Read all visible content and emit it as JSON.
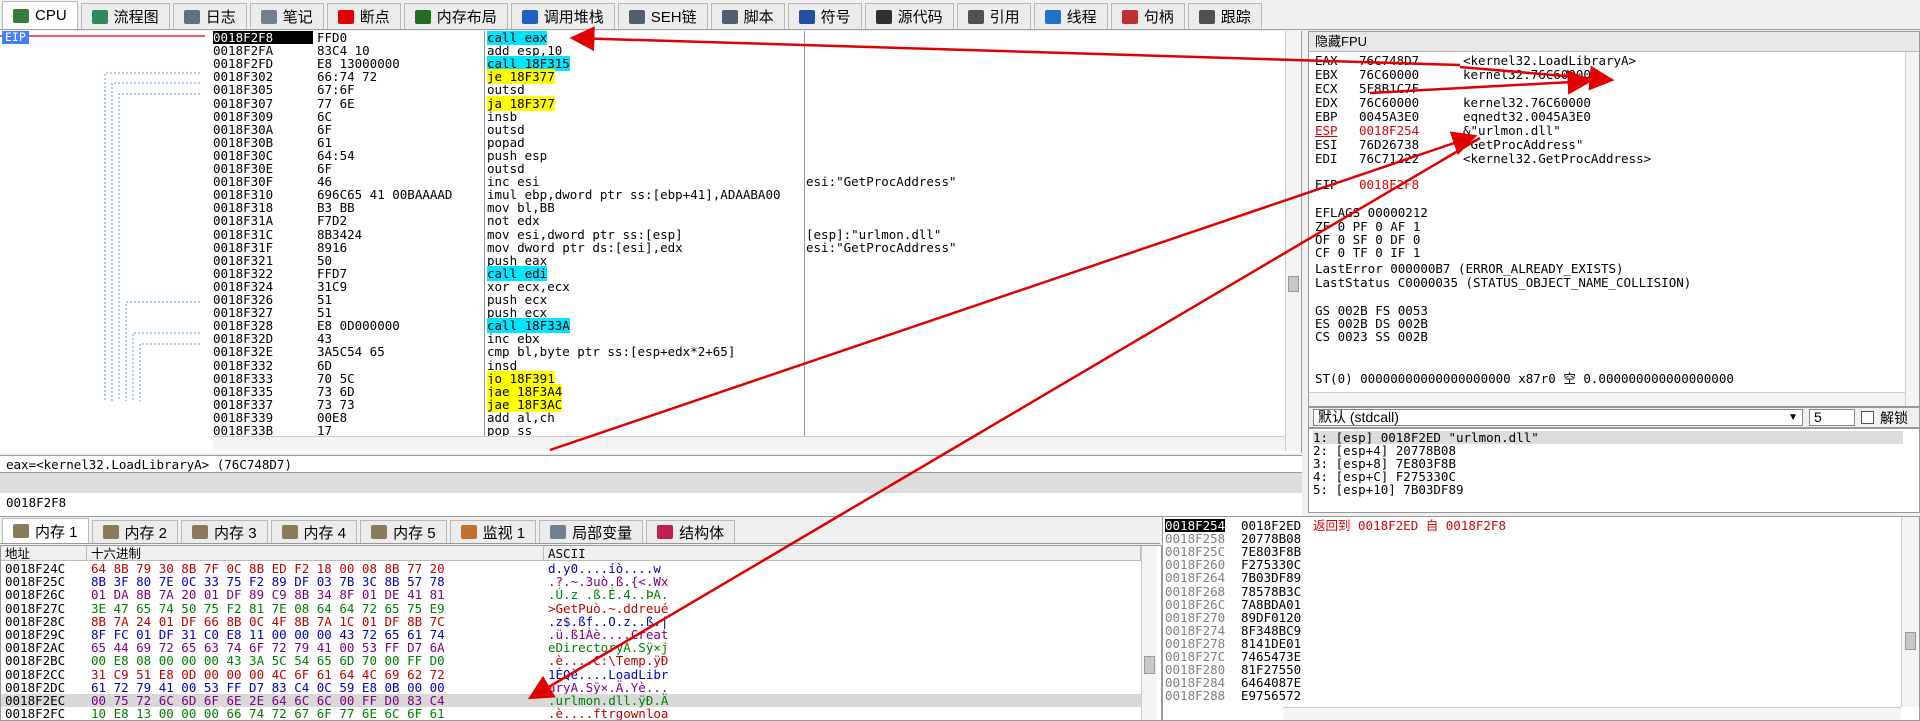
{
  "tabs": [
    {
      "label": "CPU",
      "icon": "cpu-icon",
      "color": "#3a7a3a"
    },
    {
      "label": "流程图",
      "icon": "graph-icon",
      "color": "#2e8b57"
    },
    {
      "label": "日志",
      "icon": "log-icon",
      "color": "#607080"
    },
    {
      "label": "笔记",
      "icon": "notes-icon",
      "color": "#708090"
    },
    {
      "label": "断点",
      "icon": "breakpoint-icon",
      "color": "#e00000"
    },
    {
      "label": "内存布局",
      "icon": "memory-map-icon",
      "color": "#207020"
    },
    {
      "label": "调用堆栈",
      "icon": "call-stack-icon",
      "color": "#2060c0"
    },
    {
      "label": "SEH链",
      "icon": "seh-icon",
      "color": "#506070"
    },
    {
      "label": "脚本",
      "icon": "script-icon",
      "color": "#506070"
    },
    {
      "label": "符号",
      "icon": "symbols-icon",
      "color": "#2050a0"
    },
    {
      "label": "源代码",
      "icon": "source-icon",
      "color": "#303030"
    },
    {
      "label": "引用",
      "icon": "references-icon",
      "color": "#505050"
    },
    {
      "label": "线程",
      "icon": "threads-icon",
      "color": "#2070d0"
    },
    {
      "label": "句柄",
      "icon": "handles-icon",
      "color": "#c03030"
    },
    {
      "label": "跟踪",
      "icon": "trace-icon",
      "color": "#505050"
    }
  ],
  "disasm": {
    "eip_label": "EIP",
    "rows": [
      {
        "addr": "0018F2F8",
        "bytes": "FFD0",
        "ins": "call eax",
        "cmt": ""
      },
      {
        "addr": "0018F2FA",
        "bytes": "83C4 10",
        "ins": "add esp,10",
        "cmt": ""
      },
      {
        "addr": "0018F2FD",
        "bytes": "E8 13000000",
        "ins": "call 18F315",
        "cmt": ""
      },
      {
        "addr": "0018F302",
        "bytes": "66:74 72",
        "ins": "je 18F377",
        "cmt": ""
      },
      {
        "addr": "0018F305",
        "bytes": "67:6F",
        "ins": "outsd",
        "cmt": ""
      },
      {
        "addr": "0018F307",
        "bytes": "77 6E",
        "ins": "ja 18F377",
        "cmt": ""
      },
      {
        "addr": "0018F309",
        "bytes": "6C",
        "ins": "insb",
        "cmt": ""
      },
      {
        "addr": "0018F30A",
        "bytes": "6F",
        "ins": "outsd",
        "cmt": ""
      },
      {
        "addr": "0018F30B",
        "bytes": "61",
        "ins": "popad",
        "cmt": ""
      },
      {
        "addr": "0018F30C",
        "bytes": "64:54",
        "ins": "push esp",
        "cmt": ""
      },
      {
        "addr": "0018F30E",
        "bytes": "6F",
        "ins": "outsd",
        "cmt": ""
      },
      {
        "addr": "0018F30F",
        "bytes": "46",
        "ins": "inc esi",
        "cmt": "esi:\"GetProcAddress\""
      },
      {
        "addr": "0018F310",
        "bytes": "696C65 41 00BAAAAD",
        "ins": "imul ebp,dword ptr ss:[ebp+41],ADAABA00",
        "cmt": ""
      },
      {
        "addr": "0018F318",
        "bytes": "B3 BB",
        "ins": "mov bl,BB",
        "cmt": ""
      },
      {
        "addr": "0018F31A",
        "bytes": "F7D2",
        "ins": "not edx",
        "cmt": ""
      },
      {
        "addr": "0018F31C",
        "bytes": "8B3424",
        "ins": "mov esi,dword ptr ss:[esp]",
        "cmt": "[esp]:\"urlmon.dll\""
      },
      {
        "addr": "0018F31F",
        "bytes": "8916",
        "ins": "mov dword ptr ds:[esi],edx",
        "cmt": "esi:\"GetProcAddress\""
      },
      {
        "addr": "0018F321",
        "bytes": "50",
        "ins": "push eax",
        "cmt": ""
      },
      {
        "addr": "0018F322",
        "bytes": "FFD7",
        "ins": "call edi",
        "cmt": ""
      },
      {
        "addr": "0018F324",
        "bytes": "31C9",
        "ins": "xor ecx,ecx",
        "cmt": ""
      },
      {
        "addr": "0018F326",
        "bytes": "51",
        "ins": "push ecx",
        "cmt": ""
      },
      {
        "addr": "0018F327",
        "bytes": "51",
        "ins": "push ecx",
        "cmt": ""
      },
      {
        "addr": "0018F328",
        "bytes": "E8 0D000000",
        "ins": "call 18F33A",
        "cmt": ""
      },
      {
        "addr": "0018F32D",
        "bytes": "43",
        "ins": "inc ebx",
        "cmt": ""
      },
      {
        "addr": "0018F32E",
        "bytes": "3A5C54 65",
        "ins": "cmp bl,byte ptr ss:[esp+edx*2+65]",
        "cmt": ""
      },
      {
        "addr": "0018F332",
        "bytes": "6D",
        "ins": "insd",
        "cmt": ""
      },
      {
        "addr": "0018F333",
        "bytes": "70 5C",
        "ins": "jo 18F391",
        "cmt": ""
      },
      {
        "addr": "0018F335",
        "bytes": "73 6D",
        "ins": "jae 18F3A4",
        "cmt": ""
      },
      {
        "addr": "0018F337",
        "bytes": "73 73",
        "ins": "jae 18F3AC",
        "cmt": ""
      },
      {
        "addr": "0018F339",
        "bytes": "00E8",
        "ins": "add al,ch",
        "cmt": ""
      },
      {
        "addr": "0018F33B",
        "bytes": "17",
        "ins": "pop ss",
        "cmt": ""
      }
    ]
  },
  "info": {
    "line1": "eax=<kernel32.LoadLibraryA> (76C748D7)",
    "line2": "0018F2F8"
  },
  "registers": {
    "title": "隐藏FPU",
    "gp": [
      {
        "name": "EAX",
        "val": "76C748D7",
        "desc": "<kernel32.LoadLibraryA>"
      },
      {
        "name": "EBX",
        "val": "76C60000",
        "desc": "kernel32.76C60000"
      },
      {
        "name": "ECX",
        "val": "5F8B1C7F",
        "desc": ""
      },
      {
        "name": "EDX",
        "val": "76C60000",
        "desc": "kernel32.76C60000"
      },
      {
        "name": "EBP",
        "val": "0045A3E0",
        "desc": "eqnedt32.0045A3E0"
      },
      {
        "name": "ESP",
        "val": "0018F254",
        "desc": "&\"urlmon.dll\""
      },
      {
        "name": "ESI",
        "val": "76D26738",
        "desc": "\"GetProcAddress\""
      },
      {
        "name": "EDI",
        "val": "76C71222",
        "desc": "<kernel32.GetProcAddress>"
      }
    ],
    "eip": {
      "name": "EIP",
      "val": "0018F2F8"
    },
    "eflags": "EFLAGS   00000212",
    "flags": [
      "ZF 0  PF 0  AF 1",
      "OF 0  SF 0  DF 0",
      "CF 0  TF 0  IF 1"
    ],
    "lasterror": "LastError  000000B7 (ERROR_ALREADY_EXISTS)",
    "laststatus": "LastStatus C0000035 (STATUS_OBJECT_NAME_COLLISION)",
    "segs": [
      "GS 002B  FS 0053",
      "ES 002B  DS 002B",
      "CS 0023  SS 002B"
    ],
    "st0": "ST(0) 00000000000000000000 x87r0 空 0.000000000000000000"
  },
  "callconv": {
    "selected": "默认 (stdcall)",
    "count": "5",
    "unlock_label": "解锁",
    "rows": [
      "1: [esp] 0018F2ED \"urlmon.dll\"",
      "2: [esp+4] 20778B08",
      "3: [esp+8] 7E803F8B",
      "4: [esp+C] F275330C",
      "5: [esp+10] 7B03DF89"
    ]
  },
  "memtabs": [
    {
      "label": "内存 1"
    },
    {
      "label": "内存 2"
    },
    {
      "label": "内存 3"
    },
    {
      "label": "内存 4"
    },
    {
      "label": "内存 5"
    },
    {
      "label": "监视 1"
    },
    {
      "label": "局部变量"
    },
    {
      "label": "结构体"
    }
  ],
  "dump": {
    "headers": {
      "addr": "地址",
      "hex": "十六进制",
      "ascii": "ASCII"
    },
    "rows": [
      {
        "addr": "0018F24C",
        "hex": "64 8B 79 30 8B 7F 0C 8B ED F2 18 00 08 8B 77 20",
        "ascii": "d.y0....íò....w "
      },
      {
        "addr": "0018F25C",
        "hex": "8B 3F 80 7E 0C 33 75 F2 89 DF 03 7B 3C 8B 57 78",
        "ascii": ".?.~.3uò.ß.{<.Wx"
      },
      {
        "addr": "0018F26C",
        "hex": "01 DA 8B 7A 20 01 DF 89 C9 8B 34 8F 01 DE 41 81",
        "ascii": ".Ú.z .ß.É.4..ÞA."
      },
      {
        "addr": "0018F27C",
        "hex": "3E 47 65 74 50 75 F2 81 7E 08 64 64 72 65 75 E9",
        "ascii": ">GetPuò.~.ddreué"
      },
      {
        "addr": "0018F28C",
        "hex": "8B 7A 24 01 DF 66 8B 0C 4F 8B 7A 1C 01 DF 8B 7C",
        "ascii": ".z$.ßf..O.z..ß.|"
      },
      {
        "addr": "0018F29C",
        "hex": "8F FC 01 DF 31 C0 E8 11 00 00 00 43 72 65 61 74",
        "ascii": ".ü.ß1Àè....Creat"
      },
      {
        "addr": "0018F2AC",
        "hex": "65 44 69 72 65 63 74 6F 72 79 41 00 53 FF D7 6A",
        "ascii": "eDirectoryA.Sÿ×j"
      },
      {
        "addr": "0018F2BC",
        "hex": "00 E8 08 00 00 00 43 3A 5C 54 65 6D 70 00 FF D0",
        "ascii": ".è....C:\\Temp.ÿÐ"
      },
      {
        "addr": "0018F2CC",
        "hex": "31 C9 51 E8 0D 00 00 00 4C 6F 61 64 4C 69 62 72",
        "ascii": "1ÉQè....LoadLibr"
      },
      {
        "addr": "0018F2DC",
        "hex": "61 72 79 41 00 53 FF D7 83 C4 0C 59 E8 0B 00 00",
        "ascii": "aryA.Sÿ×.Ä.Yè..."
      },
      {
        "addr": "0018F2EC",
        "hex": "00 75 72 6C 6D 6F 6E 2E 64 6C 6C 00 FF D0 83 C4",
        "ascii": ".urlmon.dll.ÿÐ.Ä"
      },
      {
        "addr": "0018F2FC",
        "hex": "10 E8 13 00 00 00 66 74 72 67 6F 77 6E 6C 6F 61",
        "ascii": ".è....ftrgownloa"
      }
    ]
  },
  "stack": {
    "rows": [
      {
        "addr": "0018F254",
        "val": "0018F2ED",
        "cmt": "返回到 0018F2ED 自 0018F2F8"
      },
      {
        "addr": "0018F258",
        "val": "20778B08",
        "cmt": ""
      },
      {
        "addr": "0018F25C",
        "val": "7E803F8B",
        "cmt": ""
      },
      {
        "addr": "0018F260",
        "val": "F275330C",
        "cmt": ""
      },
      {
        "addr": "0018F264",
        "val": "7B03DF89",
        "cmt": ""
      },
      {
        "addr": "0018F268",
        "val": "78578B3C",
        "cmt": ""
      },
      {
        "addr": "0018F26C",
        "val": "7A8BDA01",
        "cmt": ""
      },
      {
        "addr": "0018F270",
        "val": "89DF0120",
        "cmt": ""
      },
      {
        "addr": "0018F274",
        "val": "8F348BC9",
        "cmt": ""
      },
      {
        "addr": "0018F278",
        "val": "8141DE01",
        "cmt": ""
      },
      {
        "addr": "0018F27C",
        "val": "7465473E",
        "cmt": ""
      },
      {
        "addr": "0018F280",
        "val": "81F27550",
        "cmt": ""
      },
      {
        "addr": "0018F284",
        "val": "6464087E",
        "cmt": ""
      },
      {
        "addr": "0018F288",
        "val": "E9756572",
        "cmt": ""
      }
    ]
  }
}
